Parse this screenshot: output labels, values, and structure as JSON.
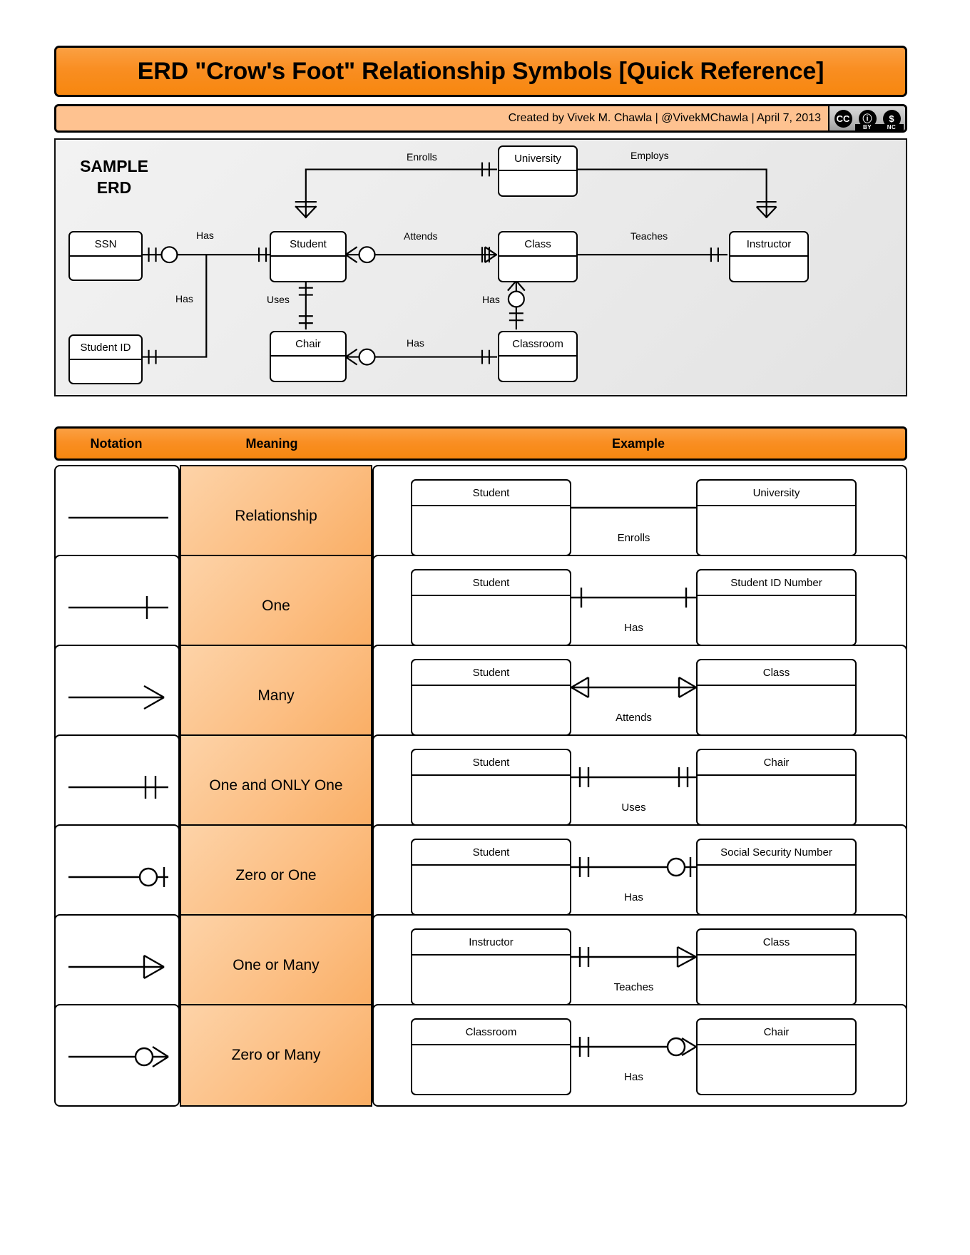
{
  "header": {
    "title": "ERD \"Crow's Foot\" Relationship Symbols [Quick Reference]",
    "attribution": "Created by Vivek M. Chawla |  @VivekMChawla  |  April 7, 2013",
    "license": {
      "cc_label": "CC",
      "by_label": "BY",
      "nc_label": "NC"
    }
  },
  "sample_erd": {
    "panel_title_line1": "SAMPLE",
    "panel_title_line2": "ERD",
    "entities": [
      {
        "name": "SSN"
      },
      {
        "name": "Student ID"
      },
      {
        "name": "Student"
      },
      {
        "name": "Chair"
      },
      {
        "name": "University"
      },
      {
        "name": "Class"
      },
      {
        "name": "Classroom"
      },
      {
        "name": "Instructor"
      }
    ],
    "relationships": [
      {
        "label": "Enrolls",
        "from": "Student",
        "to": "University"
      },
      {
        "label": "Employs",
        "from": "University",
        "to": "Instructor"
      },
      {
        "label": "Has",
        "from": "SSN",
        "to": "Student"
      },
      {
        "label": "Has",
        "from": "Student ID",
        "to": "Student"
      },
      {
        "label": "Attends",
        "from": "Student",
        "to": "Class"
      },
      {
        "label": "Teaches",
        "from": "Class",
        "to": "Instructor"
      },
      {
        "label": "Uses",
        "from": "Student",
        "to": "Chair"
      },
      {
        "label": "Has",
        "from": "Class",
        "to": "Classroom"
      },
      {
        "label": "Has",
        "from": "Chair",
        "to": "Classroom"
      }
    ]
  },
  "table": {
    "columns": {
      "notation": "Notation",
      "meaning": "Meaning",
      "example": "Example"
    },
    "rows": [
      {
        "notation": "plain-line",
        "meaning": "Relationship",
        "example": {
          "left": "Student",
          "right": "University",
          "label": "Enrolls"
        }
      },
      {
        "notation": "one-bar",
        "meaning": "One",
        "example": {
          "left": "Student",
          "right": "Student ID Number",
          "label": "Has"
        }
      },
      {
        "notation": "crows-foot",
        "meaning": "Many",
        "example": {
          "left": "Student",
          "right": "Class",
          "label": "Attends"
        }
      },
      {
        "notation": "double-bar",
        "meaning": "One and ONLY One",
        "example": {
          "left": "Student",
          "right": "Chair",
          "label": "Uses"
        }
      },
      {
        "notation": "circle-bar",
        "meaning": "Zero or One",
        "example": {
          "left": "Student",
          "right": "Social Security Number",
          "label": "Has"
        }
      },
      {
        "notation": "bar-crows-foot",
        "meaning": "One or Many",
        "example": {
          "left": "Instructor",
          "right": "Class",
          "label": "Teaches"
        }
      },
      {
        "notation": "circle-crows-foot",
        "meaning": "Zero or Many",
        "example": {
          "left": "Classroom",
          "right": "Chair",
          "label": "Has"
        }
      }
    ]
  },
  "colors": {
    "accent_orange": "#f7870f",
    "accent_orange_light": "#fba043",
    "meaning_fill": "#fcbf84",
    "attrib_fill": "#fec290",
    "panel_fill": "#ebebeb"
  }
}
